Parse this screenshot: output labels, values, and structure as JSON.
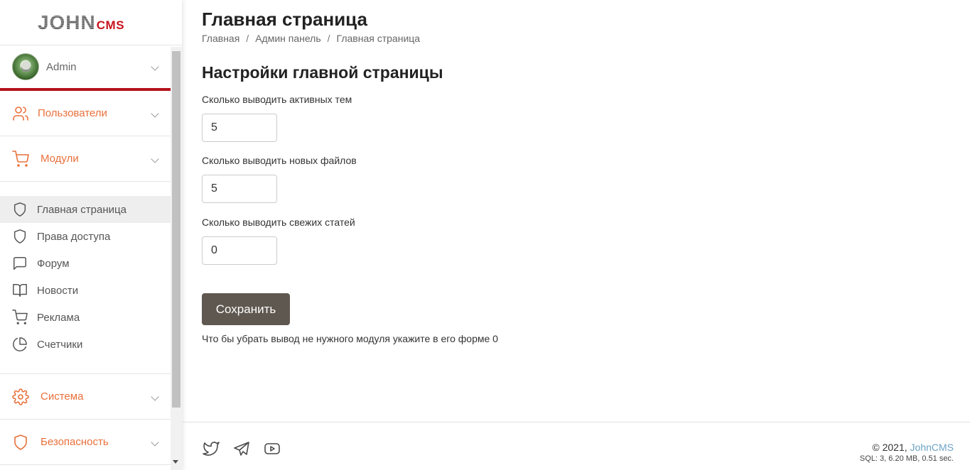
{
  "logo": {
    "part1": "JOHN",
    "part2": "CMS"
  },
  "user": {
    "name": "Admin"
  },
  "sidebar": {
    "sections_top": [
      {
        "label": "Пользователи",
        "icon": "users-icon"
      },
      {
        "label": "Модули",
        "icon": "cart-icon"
      }
    ],
    "items": [
      {
        "label": "Главная страница",
        "icon": "shield-icon",
        "active": true
      },
      {
        "label": "Права доступа",
        "icon": "shield-icon"
      },
      {
        "label": "Форум",
        "icon": "chat-icon"
      },
      {
        "label": "Новости",
        "icon": "book-icon"
      },
      {
        "label": "Реклама",
        "icon": "cart-icon"
      },
      {
        "label": "Счетчики",
        "icon": "pie-chart-icon"
      }
    ],
    "sections_bottom": [
      {
        "label": "Система",
        "icon": "gear-icon"
      },
      {
        "label": "Безопасность",
        "icon": "shield-icon"
      }
    ]
  },
  "header": {
    "title": "Главная страница",
    "breadcrumb": [
      "Главная",
      "Админ панель",
      "Главная страница"
    ]
  },
  "form": {
    "title": "Настройки главной страницы",
    "fields": [
      {
        "label": "Сколько выводить активных тем",
        "value": "5"
      },
      {
        "label": "Сколько выводить новых файлов",
        "value": "5"
      },
      {
        "label": "Сколько выводить свежих статей",
        "value": "0"
      }
    ],
    "save_label": "Сохранить",
    "hint": "Что бы убрать вывод не нужного модуля укажите в его форме 0"
  },
  "footer": {
    "copyright_prefix": "© 2021, ",
    "copyright_link": "JohnCMS",
    "stats": "SQL: 3, 6.20 MB, 0.51 sec.",
    "social": [
      "twitter-icon",
      "telegram-icon",
      "youtube-icon"
    ]
  },
  "colors": {
    "accent": "#e8703a",
    "brand_red": "#b5121b",
    "button": "#5f5850",
    "link": "#6ba3c6"
  }
}
